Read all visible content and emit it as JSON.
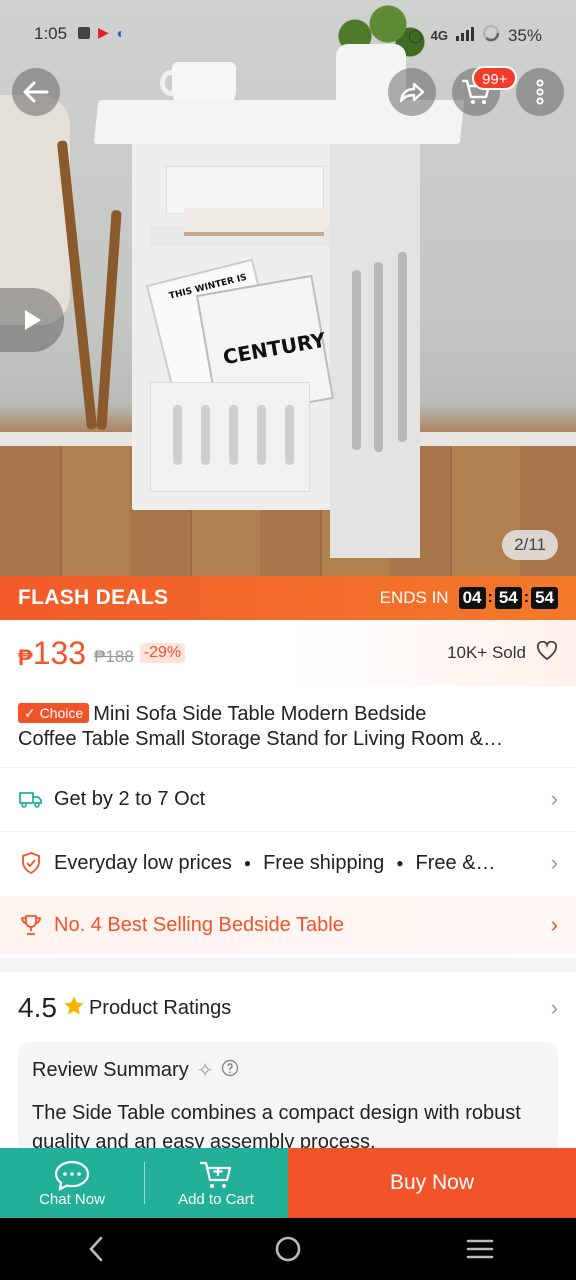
{
  "status_bar": {
    "time": "1:05",
    "network": "4G",
    "battery": "35%"
  },
  "hero": {
    "image_counter": "2/11",
    "cart_badge": "99+",
    "book_text_1": "THIS WINTER IS",
    "book_text_2": "CENTURY"
  },
  "flash_deals": {
    "title": "FLASH DEALS",
    "ends_label": "ENDS IN",
    "hours": "04",
    "minutes": "54",
    "seconds": "54"
  },
  "price": {
    "currency": "₱",
    "current": "133",
    "original": "₱188",
    "discount": "-29%",
    "sold": "10K+ Sold"
  },
  "product": {
    "badge": "Choice",
    "title_line1": "Mini Sofa Side Table Modern Bedside",
    "title_line2": "Coffee Table Small Storage Stand for Living Room &…"
  },
  "delivery": {
    "label": "Get by 2 to 7 Oct"
  },
  "benefits": {
    "item1": "Everyday low prices",
    "item2": "Free shipping",
    "item3": "Free &…"
  },
  "bestseller": {
    "label": "No. 4 Best Selling Bedside Table"
  },
  "ratings": {
    "score": "4.5",
    "label": "Product Ratings"
  },
  "review_summary": {
    "title": "Review Summary",
    "text": "The Side Table combines a compact design with robust quality and an easy assembly process."
  },
  "bottom_bar": {
    "chat": "Chat Now",
    "add_to_cart": "Add to Cart",
    "buy_now": "Buy Now"
  },
  "colors": {
    "accent": "#f2542a",
    "teal": "#23b09a",
    "badge_red": "#f23c2a"
  }
}
